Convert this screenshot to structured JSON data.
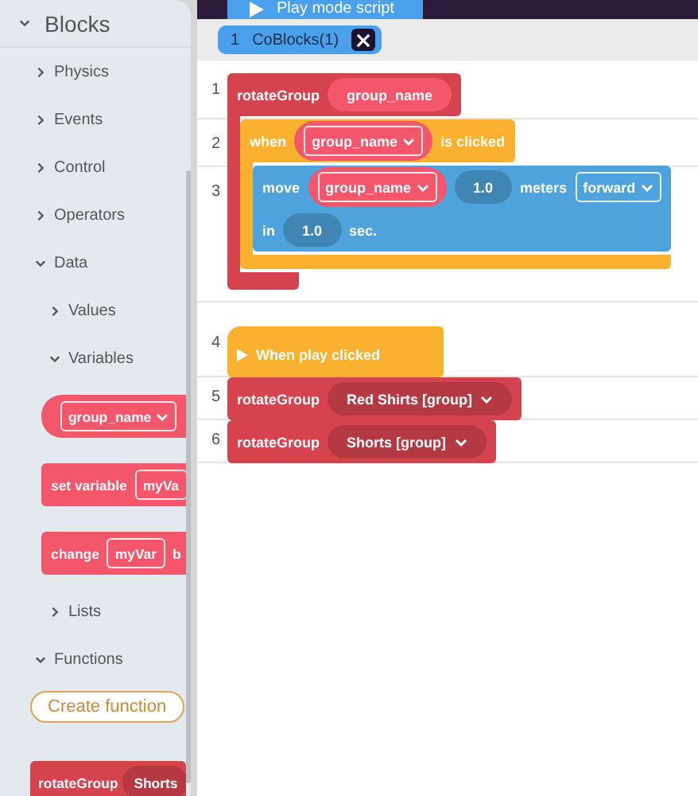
{
  "top_bar": {
    "tabs": [
      {
        "label": "Play mode script",
        "selected": true
      }
    ]
  },
  "file_tabs": [
    {
      "number": "1",
      "label": "CoBlocks(1)",
      "selected": true
    }
  ],
  "sidebar": {
    "title": "Blocks",
    "expanded": true,
    "items": [
      {
        "kind": "category",
        "label": "Physics",
        "expanded": false
      },
      {
        "kind": "category",
        "label": "Events",
        "expanded": false
      },
      {
        "kind": "category",
        "label": "Control",
        "expanded": false
      },
      {
        "kind": "category",
        "label": "Operators",
        "expanded": false
      },
      {
        "kind": "category",
        "label": "Data",
        "expanded": true,
        "children": [
          {
            "kind": "category",
            "label": "Values",
            "expanded": false
          },
          {
            "kind": "category",
            "label": "Variables",
            "expanded": true,
            "children": [
              {
                "kind": "block",
                "block": {
                  "kind": "reporter",
                  "color": "#f4566b",
                  "rows": [
                    [
                      {
                        "kind": "dropdown",
                        "text": "group_name"
                      }
                    ]
                  ]
                }
              },
              {
                "kind": "block",
                "block": {
                  "kind": "stack",
                  "color": "#f4566b",
                  "rows": [
                    [
                      {
                        "kind": "label",
                        "text": "set variable"
                      },
                      {
                        "kind": "field",
                        "text": "myVa"
                      }
                    ]
                  ]
                }
              },
              {
                "kind": "block",
                "block": {
                  "kind": "stack",
                  "color": "#f4566b",
                  "rows": [
                    [
                      {
                        "kind": "label",
                        "text": "change"
                      },
                      {
                        "kind": "field",
                        "text": "myVar"
                      },
                      {
                        "kind": "label",
                        "text": "b"
                      }
                    ]
                  ]
                }
              }
            ]
          },
          {
            "kind": "category",
            "label": "Lists",
            "expanded": false
          }
        ]
      },
      {
        "kind": "category",
        "label": "Functions",
        "expanded": true,
        "children": [
          {
            "kind": "button",
            "label": "Create function"
          },
          {
            "kind": "block",
            "block": {
              "kind": "stack",
              "color": "#d5434f",
              "rows": [
                [
                  {
                    "kind": "label",
                    "text": "rotateGroup"
                  },
                  {
                    "kind": "pill",
                    "text": "Shorts"
                  }
                ]
              ]
            }
          }
        ]
      }
    ]
  },
  "editor": {
    "line_numbers": [
      "1",
      "2",
      "3",
      "4",
      "5",
      "6"
    ],
    "stacks": [
      [
        {
          "kind": "c",
          "color": "#d5434f",
          "rows": [
            [
              {
                "kind": "label",
                "text": "rotateGroup"
              },
              {
                "kind": "reporter",
                "text": "group_name"
              }
            ]
          ],
          "inner": [
            {
              "kind": "c",
              "color": "#fbb130",
              "rows": [
                [
                  {
                    "kind": "label",
                    "text": "when"
                  },
                  {
                    "kind": "reporter_dropdown",
                    "text": "group_name"
                  },
                  {
                    "kind": "label",
                    "text": "is clicked"
                  }
                ]
              ],
              "inner": [
                {
                  "kind": "stack",
                  "color": "#4ea3dc",
                  "lines": [
                    [
                      {
                        "kind": "label",
                        "text": "move"
                      },
                      {
                        "kind": "reporter_dropdown",
                        "text": "group_name"
                      },
                      {
                        "kind": "number",
                        "text": "1.0"
                      },
                      {
                        "kind": "label",
                        "text": "meters"
                      },
                      {
                        "kind": "dropdown",
                        "text": "forward"
                      }
                    ],
                    [
                      {
                        "kind": "label",
                        "text": "in"
                      },
                      {
                        "kind": "number",
                        "text": "1.0"
                      },
                      {
                        "kind": "label",
                        "text": "sec."
                      }
                    ]
                  ]
                }
              ]
            }
          ]
        }
      ],
      [
        {
          "kind": "hat",
          "color": "#fbb130",
          "rows": [
            [
              {
                "kind": "label",
                "text": "When play clicked"
              }
            ]
          ]
        },
        {
          "kind": "stack",
          "color": "#d5434f",
          "rows": [
            [
              {
                "kind": "label",
                "text": "rotateGroup"
              },
              {
                "kind": "menu",
                "text": "Red Shirts [group]"
              }
            ]
          ]
        },
        {
          "kind": "stack",
          "color": "#d5434f",
          "rows": [
            [
              {
                "kind": "label",
                "text": "rotateGroup"
              },
              {
                "kind": "menu",
                "text": "Shorts [group]"
              }
            ]
          ]
        }
      ]
    ]
  }
}
